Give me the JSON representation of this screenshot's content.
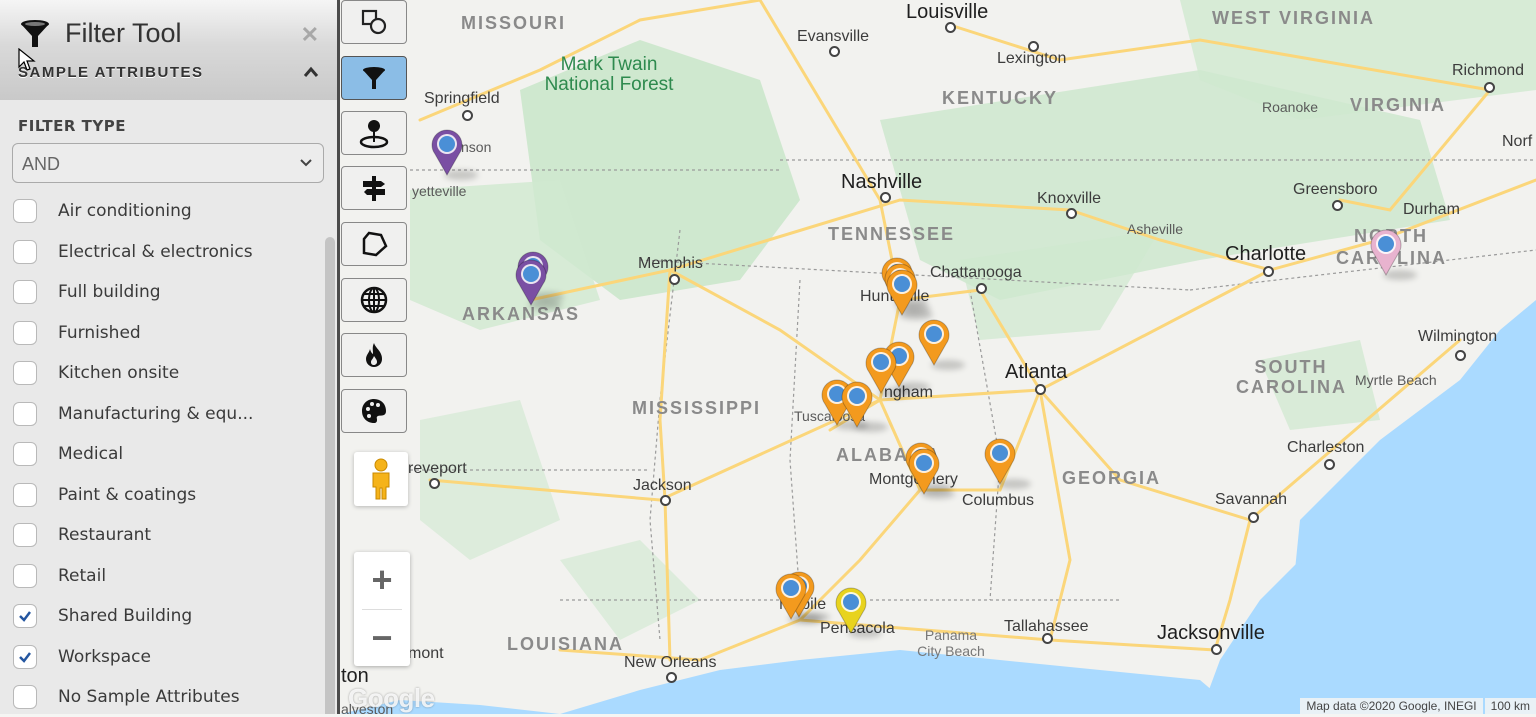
{
  "panel": {
    "title": "Filter Tool",
    "close_icon": "close-icon",
    "section_title": "SAMPLE ATTRIBUTES",
    "filter_type_label": "FILTER TYPE",
    "filter_type_value": "AND",
    "attributes": [
      {
        "label": "Air conditioning",
        "checked": false
      },
      {
        "label": "Electrical & electronics",
        "checked": false
      },
      {
        "label": "Full building",
        "checked": false
      },
      {
        "label": "Furnished",
        "checked": false
      },
      {
        "label": "Kitchen onsite",
        "checked": false
      },
      {
        "label": "Manufacturing & equ...",
        "checked": false
      },
      {
        "label": "Medical",
        "checked": false
      },
      {
        "label": "Paint & coatings",
        "checked": false
      },
      {
        "label": "Restaurant",
        "checked": false
      },
      {
        "label": "Retail",
        "checked": false
      },
      {
        "label": "Shared Building",
        "checked": true
      },
      {
        "label": "Workspace",
        "checked": true
      },
      {
        "label": "No Sample Attributes",
        "checked": false
      }
    ]
  },
  "toolbar": {
    "tools": [
      {
        "name": "shapes-tool",
        "icon": "shapes-icon",
        "active": false
      },
      {
        "name": "filter-tool",
        "icon": "funnel-icon",
        "active": true
      },
      {
        "name": "proximity-tool",
        "icon": "pin-radius-icon",
        "active": false
      },
      {
        "name": "directions-tool",
        "icon": "signpost-icon",
        "active": false
      },
      {
        "name": "polygon-tool",
        "icon": "polygon-icon",
        "active": false
      },
      {
        "name": "boundaries-tool",
        "icon": "globe-icon",
        "active": false
      },
      {
        "name": "heatmap-tool",
        "icon": "fire-icon",
        "active": false
      },
      {
        "name": "color-tool",
        "icon": "palette-icon",
        "active": false
      }
    ],
    "zoom_in": "+",
    "zoom_out": "−"
  },
  "map": {
    "colors": {
      "marker_orange": "#f39a1e",
      "marker_purple": "#7a4fa3",
      "marker_yellow": "#e8d31e",
      "marker_pink": "#e8b3cf",
      "marker_dot": "#4a8fd6",
      "water": "#aadaff",
      "park": "#c8e6c9",
      "road": "#fbd67a"
    },
    "states": [
      {
        "name": "MISSOURI"
      },
      {
        "name": "KENTUCKY"
      },
      {
        "name": "TENNESSEE"
      },
      {
        "name": "ARKANSAS"
      },
      {
        "name": "MISSISSIPPI"
      },
      {
        "name": "ALABAMA"
      },
      {
        "name": "GEORGIA"
      },
      {
        "name": "LOUISIANA"
      },
      {
        "name": "VIRGINIA"
      },
      {
        "name": "NORTH CAROLINA"
      },
      {
        "name": "SOUTH CAROLINA"
      },
      {
        "name": "WEST VIRGINIA"
      }
    ],
    "cities": {
      "louisville": "Louisville",
      "evansville": "Evansville",
      "lexington": "Lexington",
      "springfield": "Springfield",
      "branson": "nson",
      "fayetteville": "yetteville",
      "nashville": "Nashville",
      "knoxville": "Knoxville",
      "asheville": "Asheville",
      "memphis": "Memphis",
      "chattanooga": "Chattanooga",
      "huntsville": "Huntsville",
      "birmingham": "ngham",
      "tuscaloosa": "Tuscaloosa",
      "atlanta": "Atlanta",
      "montgomery": "Montgomery",
      "columbus": "Columbus",
      "jackson": "Jackson",
      "shreveport": "reveport",
      "mobile": "Mobile",
      "pensacola": "Pensacola",
      "panama_city": "Panama City Beach",
      "tallahassee": "Tallahassee",
      "jacksonville": "Jacksonville",
      "savannah": "Savannah",
      "charleston": "Charleston",
      "myrtle_beach": "Myrtle Beach",
      "wilmington": "Wilmington",
      "charlotte": "Charlotte",
      "greensboro": "Greensboro",
      "durham": "Durham",
      "roanoke": "Roanoke",
      "richmond": "Richmond",
      "norfolk": "Norf",
      "new_orleans": "New Orleans",
      "beaumont": "mont",
      "houston": "ton",
      "galveston": "alveston"
    },
    "forest": "Mark Twain National Forest",
    "google_logo": "Google",
    "attribution": "Map data ©2020 Google, INEGI",
    "scale": "100 km"
  }
}
